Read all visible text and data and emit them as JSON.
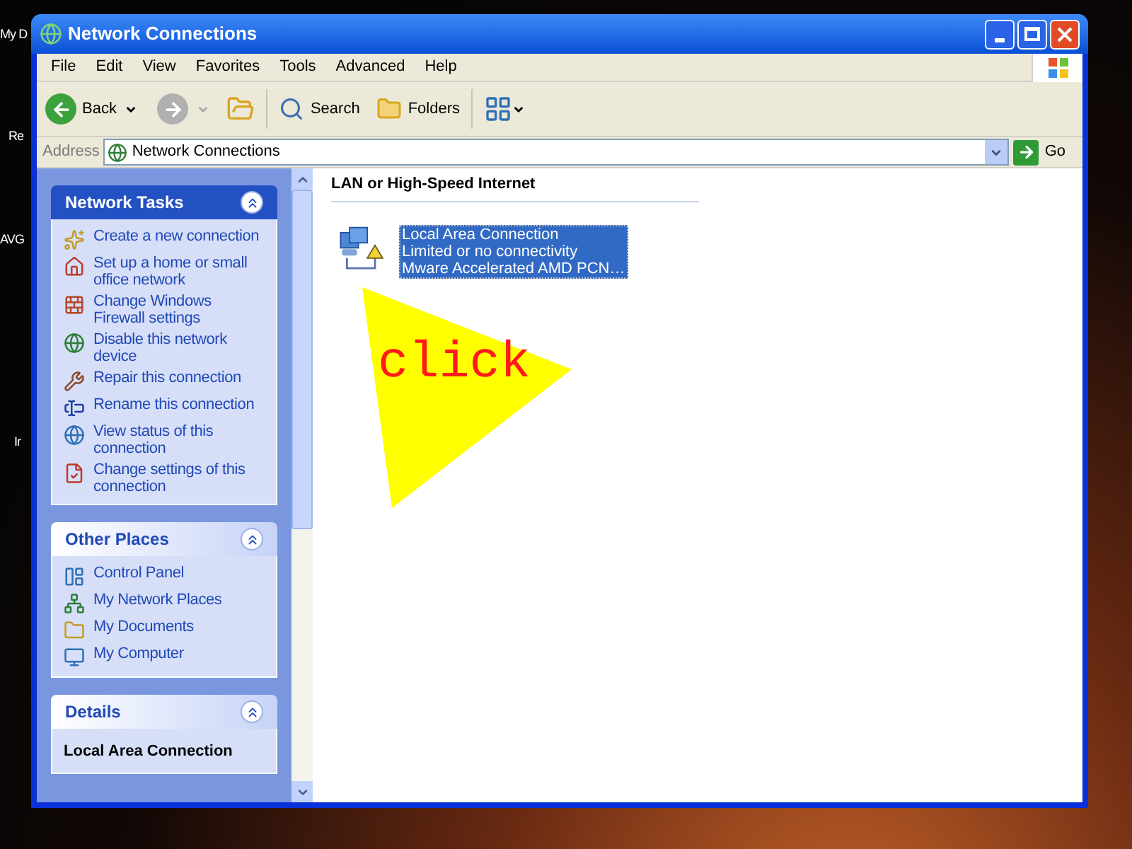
{
  "desktop_icons": [
    {
      "label": "My D"
    },
    {
      "label": "Re"
    },
    {
      "label": "AVG"
    },
    {
      "label": "Ir"
    }
  ],
  "window": {
    "title": "Network Connections"
  },
  "menu": [
    "File",
    "Edit",
    "View",
    "Favorites",
    "Tools",
    "Advanced",
    "Help"
  ],
  "toolbar": {
    "back": "Back",
    "search": "Search",
    "folders": "Folders"
  },
  "address": {
    "label": "Address",
    "value": "Network Connections",
    "go": "Go"
  },
  "task_panels": [
    {
      "title": "Network Tasks",
      "kind": "primary",
      "expanded": true,
      "items": [
        "Create a new connection",
        "Set up a home or small office network",
        "Change Windows Firewall settings",
        "Disable this network device",
        "Repair this connection",
        "Rename this connection",
        "View status of this connection",
        "Change settings of this connection"
      ]
    },
    {
      "title": "Other Places",
      "kind": "normal",
      "expanded": true,
      "items": [
        "Control Panel",
        "My Network Places",
        "My Documents",
        "My Computer"
      ]
    },
    {
      "title": "Details",
      "kind": "normal",
      "expanded": true,
      "heading": "Local Area Connection"
    }
  ],
  "content": {
    "group": "LAN or High-Speed Internet",
    "connections": [
      {
        "selected": true,
        "lines": [
          "Local Area Connection",
          "Limited or no connectivity",
          "Mware Accelerated AMD PCN…"
        ]
      }
    ]
  },
  "annotation": {
    "text": "click"
  }
}
